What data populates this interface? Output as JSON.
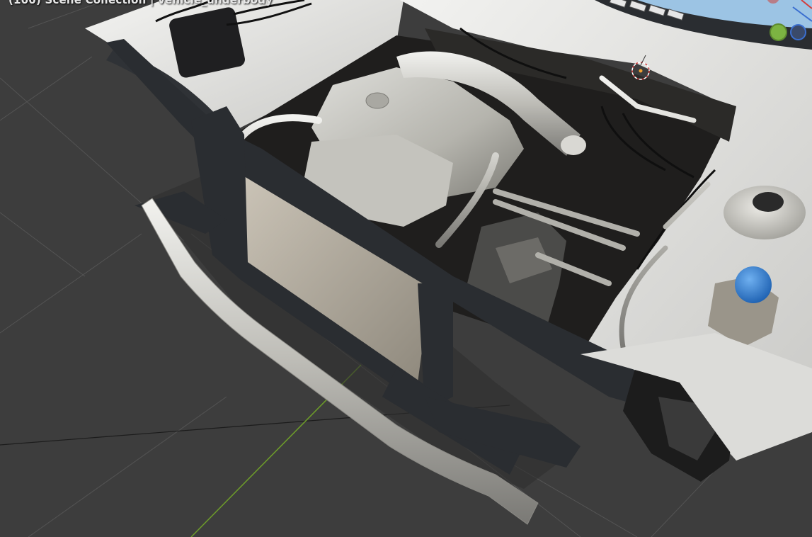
{
  "viewport": {
    "object_info": "(100) Scene Collection | vehicle_underbody"
  },
  "colors": {
    "background": "#3d3d3d",
    "grid_line": "#545454",
    "axis_x": "#a63a3a",
    "axis_y": "#6c9a2a",
    "frame": "#2a2d31",
    "engine_metal": "#bdbcb6",
    "body_panel": "#e9e9e7",
    "reservoir_cap": "#2f7ed8",
    "gizmo_y": "#7cb342",
    "gizmo_z": "#3b6fd0",
    "cursor_3d": "#d33b3b"
  },
  "navigation_gizmo": {
    "icons": [
      "axis-y-dot-icon",
      "axis-z-dot-icon"
    ]
  }
}
